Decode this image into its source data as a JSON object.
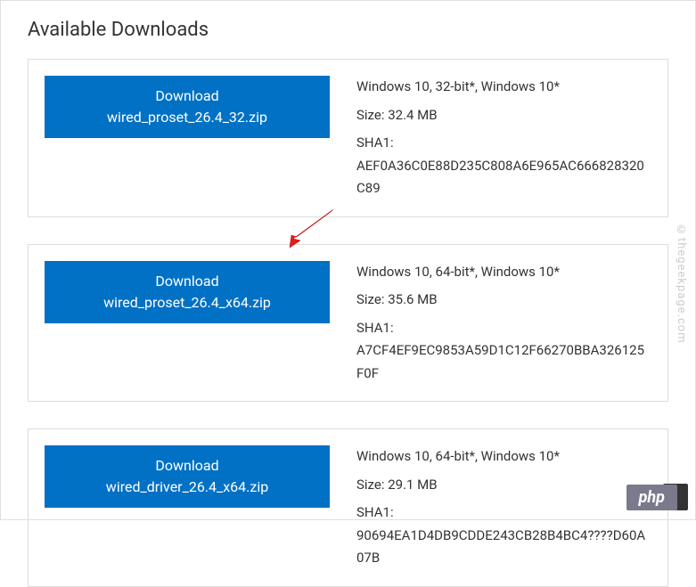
{
  "title": "Available Downloads",
  "watermark": "©thegeekpage.com",
  "php_badge": "php",
  "downloads": [
    {
      "label": "Download",
      "filename": "wired_proset_26.4_32.zip",
      "os": "Windows 10, 32-bit*, Windows 10*",
      "size_label": "Size:",
      "size": "32.4 MB",
      "sha_label": "SHA1:",
      "sha": "AEF0A36C0E88D235C808A6E965AC666828320C89"
    },
    {
      "label": "Download",
      "filename": "wired_proset_26.4_x64.zip",
      "os": "Windows 10, 64-bit*, Windows 10*",
      "size_label": "Size:",
      "size": "35.6 MB",
      "sha_label": "SHA1:",
      "sha": "A7CF4EF9EC9853A59D1C12F66270BBA326125F0F"
    },
    {
      "label": "Download",
      "filename": "wired_driver_26.4_x64.zip",
      "os": "Windows 10, 64-bit*, Windows 10*",
      "size_label": "Size:",
      "size": "29.1 MB",
      "sha_label": "SHA1:",
      "sha": "90694EA1D4DB9CDDE243CB28B4BC4????D60A07B"
    }
  ]
}
